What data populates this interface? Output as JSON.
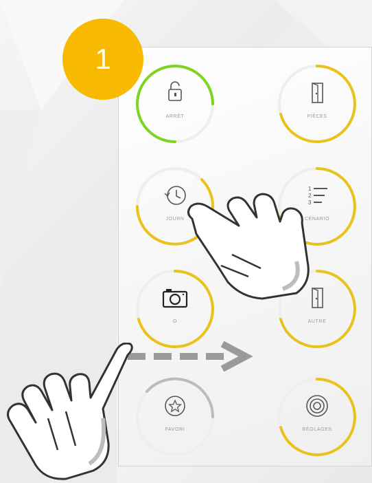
{
  "step_badge": {
    "number": "1",
    "color": "#f7ba00"
  },
  "colors": {
    "ring_yellow": "#e9c21c",
    "ring_green": "#7ed421",
    "ring_grey": "#bcbcbc",
    "icon": "#555555"
  },
  "tiles": [
    {
      "label": "ARRÊT",
      "icon": "padlock-open-icon",
      "ring": "green"
    },
    {
      "label": "PIÈCES",
      "icon": "door-icon",
      "ring": "yellow"
    },
    {
      "label": "JOURN",
      "icon": "history-clock-icon",
      "ring": "yellow"
    },
    {
      "label": "CENARIO",
      "icon": "numbered-list-icon",
      "ring": "yellow"
    },
    {
      "label": "O",
      "icon": "camera-icon",
      "ring": "yellow"
    },
    {
      "label": "AUTRE",
      "icon": "door-icon",
      "ring": "yellow"
    },
    {
      "label": "FAVORI",
      "icon": "star-icon",
      "ring": "grey"
    },
    {
      "label": "RÉGLAGES",
      "icon": "settings-disc-icon",
      "ring": "yellow"
    }
  ],
  "gesture": {
    "tap_hand": "hand-pointer-icon",
    "swipe_hand": "hand-pointer-icon",
    "swipe_direction": "right"
  }
}
